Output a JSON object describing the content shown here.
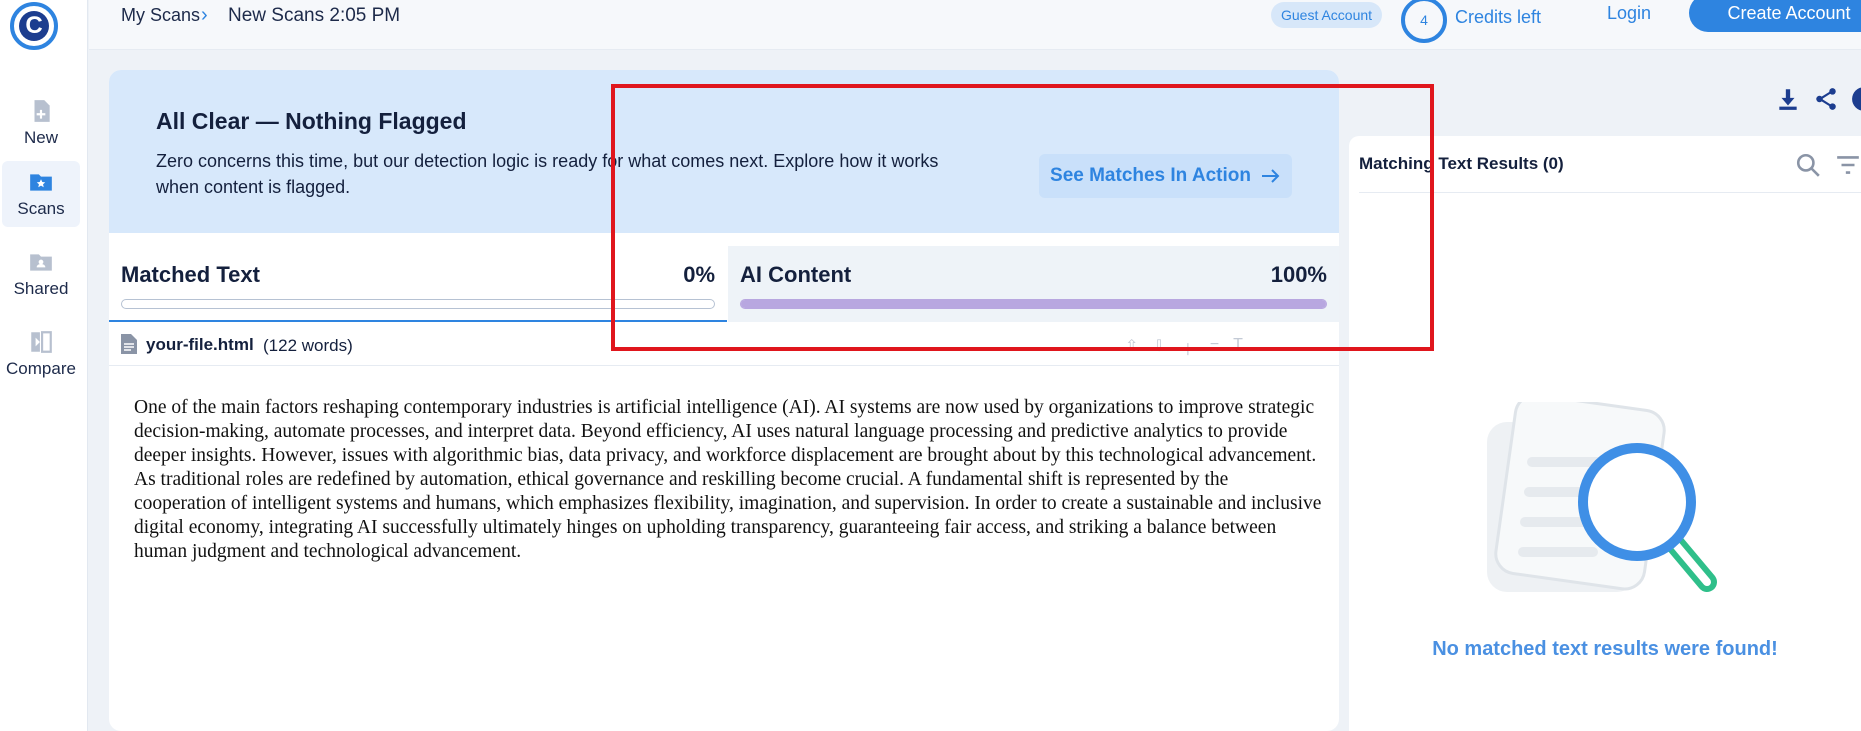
{
  "sidebar": {
    "logo_letter": "C",
    "items": [
      {
        "label": "New",
        "icon": "new-document-icon"
      },
      {
        "label": "Scans",
        "icon": "star-folder-icon"
      },
      {
        "label": "Shared",
        "icon": "shared-folder-icon"
      },
      {
        "label": "Compare",
        "icon": "compare-icon"
      }
    ]
  },
  "header": {
    "breadcrumb_root": "My Scans",
    "breadcrumb_current": "New Scans 2:05 PM",
    "guest_badge": "Guest Account",
    "credits_count": "4",
    "credits_label": "Credits left",
    "login_label": "Login",
    "create_account_label": "Create Account"
  },
  "banner": {
    "title": "All Clear — Nothing Flagged",
    "text": "Zero concerns this time, but our detection logic is ready for what comes next. Explore how it works when content is flagged.",
    "button_label": "See Matches In Action"
  },
  "tabs": {
    "matched": {
      "label": "Matched Text",
      "percent": "0%",
      "fill": 0
    },
    "ai": {
      "label": "AI Content",
      "percent": "100%",
      "fill": 1
    }
  },
  "file": {
    "name": "your-file.html",
    "words": "(122 words)"
  },
  "document": {
    "text": "One of the main factors reshaping contemporary industries is artificial intelligence (AI). AI systems are now used by organizations to improve strategic decision-making, automate processes, and interpret data. Beyond efficiency, AI uses natural language processing and predictive analytics to provide deeper insights. However, issues with algorithmic bias, data privacy, and workforce displacement are brought about by this technological advancement. As traditional roles are redefined by automation, ethical governance and reskilling become crucial. A fundamental shift is represented by the cooperation of intelligent systems and humans, which emphasizes flexibility, imagination, and supervision. In order to create a sustainable and inclusive digital economy, integrating AI successfully ultimately hinges on upholding transparency, guaranteeing fair access, and striking a balance between human judgment and technological advancement."
  },
  "results": {
    "title": "Matching Text Results (0)",
    "empty_message": "No matched text results were found!"
  },
  "colors": {
    "accent": "#2e84e0",
    "ai_bar": "#b8a7e0",
    "banner_bg": "#d7e8fb",
    "annotation_red": "#e0161d"
  }
}
